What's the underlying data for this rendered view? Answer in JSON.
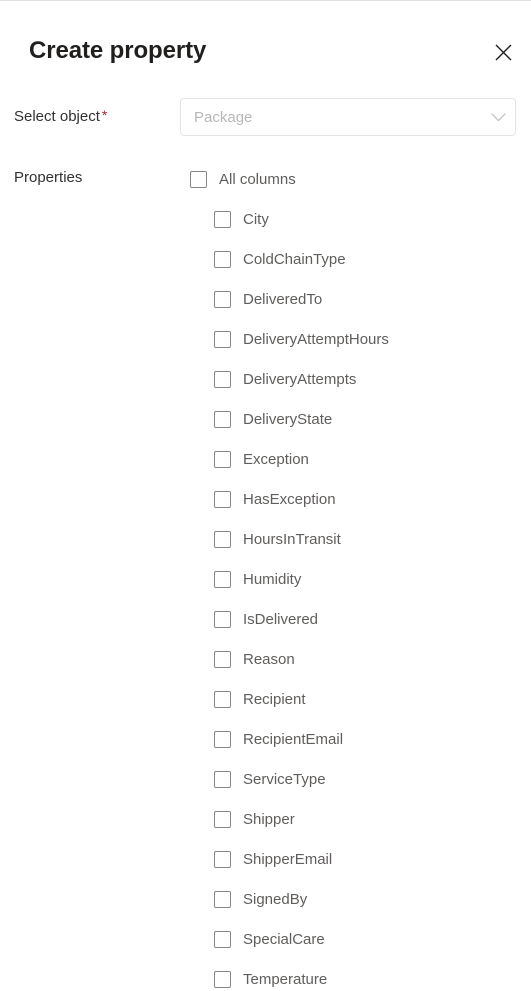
{
  "panel": {
    "title": "Create property",
    "close_icon": "close-icon"
  },
  "select_object": {
    "label": "Select object",
    "required_marker": "*",
    "dropdown": {
      "value": "",
      "placeholder": "Package",
      "chevron_icon": "chevron-down-icon"
    }
  },
  "properties": {
    "label": "Properties",
    "select_all": {
      "label": "All columns",
      "checked": false
    },
    "items": [
      {
        "label": "City",
        "checked": false
      },
      {
        "label": "ColdChainType",
        "checked": false
      },
      {
        "label": "DeliveredTo",
        "checked": false
      },
      {
        "label": "DeliveryAttemptHours",
        "checked": false
      },
      {
        "label": "DeliveryAttempts",
        "checked": false
      },
      {
        "label": "DeliveryState",
        "checked": false
      },
      {
        "label": "Exception",
        "checked": false
      },
      {
        "label": "HasException",
        "checked": false
      },
      {
        "label": "HoursInTransit",
        "checked": false
      },
      {
        "label": "Humidity",
        "checked": false
      },
      {
        "label": "IsDelivered",
        "checked": false
      },
      {
        "label": "Reason",
        "checked": false
      },
      {
        "label": "Recipient",
        "checked": false
      },
      {
        "label": "RecipientEmail",
        "checked": false
      },
      {
        "label": "ServiceType",
        "checked": false
      },
      {
        "label": "Shipper",
        "checked": false
      },
      {
        "label": "ShipperEmail",
        "checked": false
      },
      {
        "label": "SignedBy",
        "checked": false
      },
      {
        "label": "SpecialCare",
        "checked": false
      },
      {
        "label": "Temperature",
        "checked": false
      }
    ]
  },
  "colors": {
    "background": "#ffffff",
    "title_text": "#201f1e",
    "label_text": "#323130",
    "item_text": "#605e5c",
    "checkbox_border": "#8a8886",
    "field_border": "#e6e4e2",
    "placeholder_text": "#b9b7b5",
    "required_asterisk": "#a4262c",
    "panel_border": "#e1dfdd"
  }
}
